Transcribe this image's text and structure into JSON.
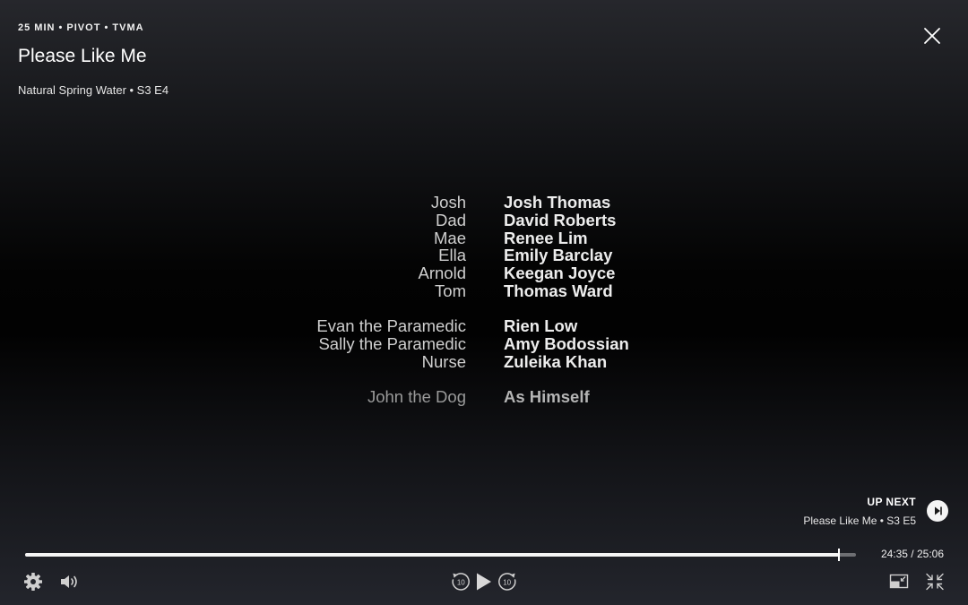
{
  "header": {
    "meta": "25 MIN • PIVOT • TVMA",
    "title": "Please Like Me",
    "episode": "Natural Spring Water • S3 E4"
  },
  "credits": [
    {
      "role": "Josh",
      "actor": "Josh Thomas"
    },
    {
      "role": "Dad",
      "actor": "David Roberts"
    },
    {
      "role": "Mae",
      "actor": "Renee Lim"
    },
    {
      "role": "Ella",
      "actor": "Emily Barclay"
    },
    {
      "role": "Arnold",
      "actor": "Keegan Joyce"
    },
    {
      "role": "Tom",
      "actor": "Thomas Ward"
    },
    {
      "role": "Evan the Paramedic",
      "actor": "Rien Low"
    },
    {
      "role": "Sally the Paramedic",
      "actor": "Amy Bodossian"
    },
    {
      "role": "Nurse",
      "actor": "Zuleika Khan"
    },
    {
      "role": "John the Dog",
      "actor": "As Himself"
    }
  ],
  "up_next": {
    "label": "UP NEXT",
    "title": "Please Like Me • S3 E5"
  },
  "player": {
    "time": "24:35 / 25:06",
    "progress_fraction": 0.9794,
    "skip_seconds": "10"
  },
  "icons": {
    "close": "close-icon",
    "settings": "gear-icon",
    "volume": "speaker-icon",
    "rewind": "rewind-10-icon",
    "play": "play-icon",
    "forward": "forward-10-icon",
    "pip": "picture-in-picture-icon",
    "exit_fullscreen": "exit-fullscreen-icon",
    "next_episode": "skip-next-icon"
  }
}
